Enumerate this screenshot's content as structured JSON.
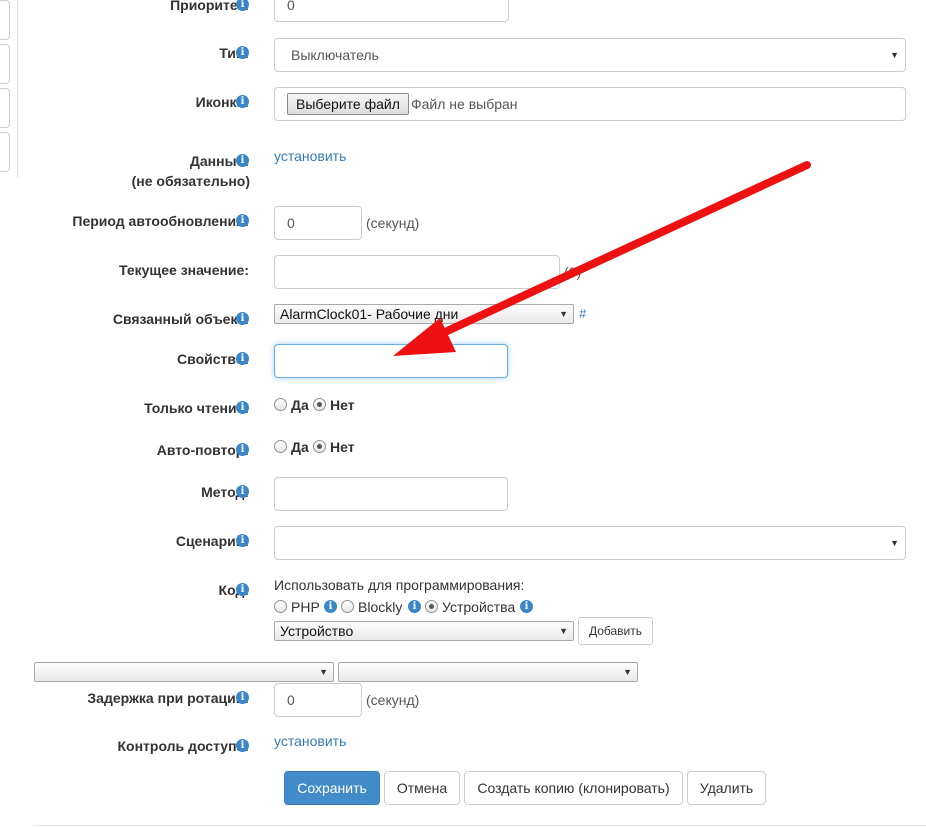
{
  "form": {
    "priority": {
      "label": "Приоритет:",
      "value": "0"
    },
    "type": {
      "label": "Тип:",
      "value": "Выключатель"
    },
    "icon": {
      "label": "Иконка:",
      "button": "Выберите файл",
      "status": "Файл не выбран"
    },
    "data": {
      "label": "Данные:",
      "sublabel": "(не обязательно)",
      "link": "установить"
    },
    "refresh": {
      "label": "Период автообновления:",
      "value": "0",
      "unit": "(секунд)"
    },
    "current_value": {
      "label": "Текущее значение:",
      "value": "",
      "suffix": "(0)"
    },
    "linked_object": {
      "label": "Связанный объект:",
      "value": "AlarmClock01- Рабочие дни",
      "hash": "#"
    },
    "property": {
      "label": "Свойство:",
      "value": ""
    },
    "read_only": {
      "label": "Только чтение:",
      "yes": "Да",
      "no": "Нет"
    },
    "auto_repeat": {
      "label": "Авто-повтор:",
      "yes": "Да",
      "no": "Нет"
    },
    "method": {
      "label": "Метод:",
      "value": ""
    },
    "scenario": {
      "label": "Сценарий:",
      "value": ""
    },
    "code": {
      "label": "Код:",
      "use_for": "Использовать для программирования:",
      "opt_php": "PHP",
      "opt_blockly": "Blockly",
      "opt_devices": "Устройства",
      "device_select": "Устройство",
      "add_button": "Добавить"
    },
    "rotation_delay": {
      "label": "Задержка при ротации:",
      "value": "0",
      "unit": "(секунд)"
    },
    "access_control": {
      "label": "Контроль доступа:",
      "link": "установить"
    }
  },
  "actions": {
    "save": "Сохранить",
    "cancel": "Отмена",
    "clone": "Создать копию (клонировать)",
    "delete": "Удалить"
  },
  "colors": {
    "arrow": "#ee1111",
    "primary": "#428bca",
    "link": "#337ab7",
    "info": "#3a87c8"
  }
}
